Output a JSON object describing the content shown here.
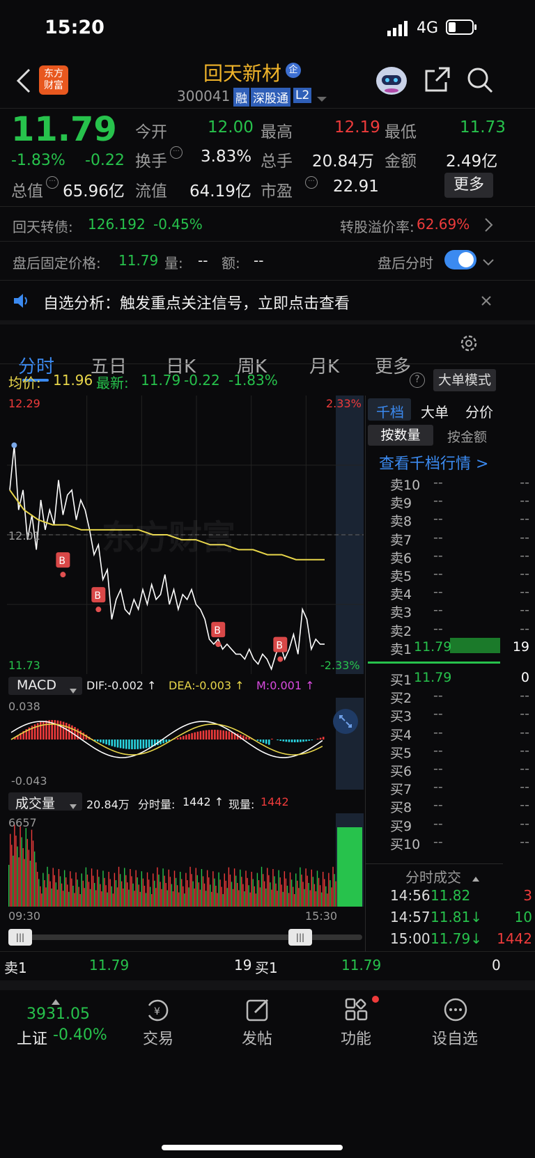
{
  "status": {
    "time": "15:20",
    "network": "4G"
  },
  "header": {
    "logo": "东方\n财富",
    "title": "回天新材",
    "title_badge": "企",
    "code": "300041",
    "tags": [
      "融",
      "深股通",
      "L2"
    ]
  },
  "quote": {
    "price": "11.79",
    "pct": "-1.83%",
    "chg": "-0.22",
    "stats": [
      {
        "label": "今开",
        "value": "12.00",
        "color": "green"
      },
      {
        "label": "最高",
        "value": "12.19",
        "color": "red"
      },
      {
        "label": "最低",
        "value": "11.73",
        "color": "green"
      },
      {
        "label": "换手",
        "value": "3.83%",
        "color": "white"
      },
      {
        "label": "总手",
        "value": "20.84万",
        "color": "white"
      },
      {
        "label": "金额",
        "value": "2.49亿",
        "color": "white"
      },
      {
        "label": "总值",
        "value": "65.96亿",
        "color": "white"
      },
      {
        "label": "流值",
        "value": "64.19亿",
        "color": "white"
      },
      {
        "label": "市盈",
        "value": "22.91",
        "color": "white"
      }
    ],
    "more_btn": "更多"
  },
  "bond": {
    "name": "回天转债:",
    "price": "126.192",
    "pct": "-0.45%",
    "premium_label": "转股溢价率:",
    "premium": "62.69%"
  },
  "afterhours": {
    "label": "盘后固定价格:",
    "price": "11.79",
    "vol_label": "量:",
    "vol": "--",
    "amt_label": "额:",
    "amt": "--",
    "toggle_label": "盘后分时"
  },
  "notice": {
    "text": "自选分析：触发重点关注信号，立即点击查看"
  },
  "tabs": [
    "分时",
    "五日",
    "日K",
    "周K",
    "月K",
    "更多"
  ],
  "chart_info": {
    "avg_label": "均价:",
    "avg": "11.96",
    "latest_label": "最新:",
    "latest": "11.79",
    "chg": "-0.22",
    "pct": "-1.83%",
    "mode_btn": "大单模式"
  },
  "chart_axes": {
    "ymax": "12.29",
    "ymid": "12.01",
    "ymin": "11.73",
    "pmax": "2.33%",
    "pmin": "-2.33%",
    "tstart": "09:30",
    "tend": "15:30",
    "watermark": "东方财富"
  },
  "macd": {
    "label": "MACD",
    "dif": "DIF:-0.002 ↑",
    "dea": "DEA:-0.003 ↑",
    "m": "M:0.001 ↑",
    "ymax": "0.038",
    "ymin": "-0.043"
  },
  "volume": {
    "label": "成交量",
    "total": "20.84万",
    "fen_label": "分时量:",
    "fen": "1442 ↑",
    "now_label": "现量:",
    "now": "1442",
    "ymax": "6657"
  },
  "chart_data": {
    "type": "line",
    "series": [
      {
        "name": "",
        "values": [
          12.1,
          12.19,
          12.06,
          12.1,
          12.0,
          12.05,
          11.98,
          12.08,
          12.02,
          12.06,
          12.03,
          12.12,
          12.05,
          12.09,
          12.1,
          12.04,
          12.08,
          12.06,
          12.02,
          11.97,
          11.99,
          11.92,
          11.94,
          11.84,
          11.88,
          11.9,
          11.86,
          11.85,
          11.88,
          11.86,
          11.9,
          11.87,
          11.91,
          11.88,
          11.89,
          11.93,
          11.87,
          11.9,
          11.86,
          11.89,
          11.88,
          11.9,
          11.87,
          11.86,
          11.84,
          11.8,
          11.79,
          11.8,
          11.78,
          11.79,
          11.78,
          11.77,
          11.77,
          11.76,
          11.78,
          11.76,
          11.75,
          11.77,
          11.76,
          11.74,
          11.77,
          11.79,
          11.76,
          11.78,
          11.81,
          11.77,
          11.86,
          11.84,
          11.78,
          11.8,
          11.79,
          11.79
        ]
      },
      {
        "name": "",
        "values": [
          12.1,
          12.06,
          12.04,
          12.03,
          12.03,
          12.02,
          12.02,
          12.02,
          12.02,
          12.02,
          12.01,
          12.01,
          12.0,
          12.0,
          11.99,
          11.99,
          11.98,
          11.98,
          11.97,
          11.97,
          11.96,
          11.96,
          11.96
        ]
      }
    ],
    "ylim": [
      11.73,
      12.29
    ]
  },
  "orderbook": {
    "tabs": [
      "千档",
      "大单",
      "分价"
    ],
    "sub": [
      "按数量",
      "按金额"
    ],
    "link": "查看千档行情 >",
    "asks": [
      {
        "l": "卖10",
        "p": "--",
        "v": "--"
      },
      {
        "l": "卖9",
        "p": "--",
        "v": "--"
      },
      {
        "l": "卖8",
        "p": "--",
        "v": "--"
      },
      {
        "l": "卖7",
        "p": "--",
        "v": "--"
      },
      {
        "l": "卖6",
        "p": "--",
        "v": "--"
      },
      {
        "l": "卖5",
        "p": "--",
        "v": "--"
      },
      {
        "l": "卖4",
        "p": "--",
        "v": "--"
      },
      {
        "l": "卖3",
        "p": "--",
        "v": "--"
      },
      {
        "l": "卖2",
        "p": "--",
        "v": "--"
      },
      {
        "l": "卖1",
        "p": "11.79",
        "v": "19"
      }
    ],
    "bids": [
      {
        "l": "买1",
        "p": "11.79",
        "v": "0"
      },
      {
        "l": "买2",
        "p": "--",
        "v": "--"
      },
      {
        "l": "买3",
        "p": "--",
        "v": "--"
      },
      {
        "l": "买4",
        "p": "--",
        "v": "--"
      },
      {
        "l": "买5",
        "p": "--",
        "v": "--"
      },
      {
        "l": "买6",
        "p": "--",
        "v": "--"
      },
      {
        "l": "买7",
        "p": "--",
        "v": "--"
      },
      {
        "l": "买8",
        "p": "--",
        "v": "--"
      },
      {
        "l": "买9",
        "p": "--",
        "v": "--"
      },
      {
        "l": "买10",
        "p": "--",
        "v": "--"
      }
    ],
    "trades_title": "分时成交",
    "trades": [
      {
        "t": "14:56",
        "p": "11.82",
        "v": "3",
        "vc": "red"
      },
      {
        "t": "14:57",
        "p": "11.81↓",
        "v": "10",
        "vc": "green"
      },
      {
        "t": "15:00",
        "p": "11.79↓",
        "v": "1442",
        "vc": "red"
      }
    ]
  },
  "bottom_quote": {
    "sell_label": "卖1",
    "sell_price": "11.79",
    "sell_vol": "19",
    "buy_label": "买1",
    "buy_price": "11.79",
    "buy_vol": "0"
  },
  "nav": {
    "index_value": "3931.05",
    "index_name": "上证",
    "index_pct": "-0.40%",
    "items": [
      "交易",
      "发帖",
      "功能",
      "设自选"
    ]
  }
}
